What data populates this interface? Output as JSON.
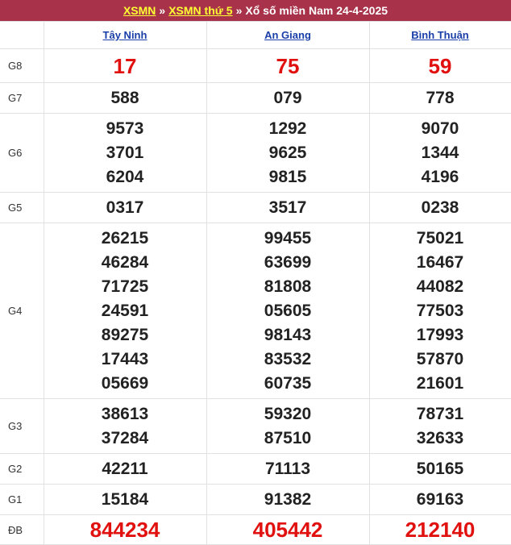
{
  "header": {
    "link1": "XSMN",
    "sep1": "»",
    "link2": "XSMN thứ 5",
    "sep2": "»",
    "title": "Xổ số miền Nam 24-4-2025"
  },
  "provinces": [
    "Tây Ninh",
    "An Giang",
    "Bình Thuận"
  ],
  "prizes": {
    "g8": {
      "label": "G8",
      "values": [
        [
          "17"
        ],
        [
          "75"
        ],
        [
          "59"
        ]
      ]
    },
    "g7": {
      "label": "G7",
      "values": [
        [
          "588"
        ],
        [
          "079"
        ],
        [
          "778"
        ]
      ]
    },
    "g6": {
      "label": "G6",
      "values": [
        [
          "9573",
          "3701",
          "6204"
        ],
        [
          "1292",
          "9625",
          "9815"
        ],
        [
          "9070",
          "1344",
          "4196"
        ]
      ]
    },
    "g5": {
      "label": "G5",
      "values": [
        [
          "0317"
        ],
        [
          "3517"
        ],
        [
          "0238"
        ]
      ]
    },
    "g4": {
      "label": "G4",
      "values": [
        [
          "26215",
          "46284",
          "71725",
          "24591",
          "89275",
          "17443",
          "05669"
        ],
        [
          "99455",
          "63699",
          "81808",
          "05605",
          "98143",
          "83532",
          "60735"
        ],
        [
          "75021",
          "16467",
          "44082",
          "77503",
          "17993",
          "57870",
          "21601"
        ]
      ]
    },
    "g3": {
      "label": "G3",
      "values": [
        [
          "38613",
          "37284"
        ],
        [
          "59320",
          "87510"
        ],
        [
          "78731",
          "32633"
        ]
      ]
    },
    "g2": {
      "label": "G2",
      "values": [
        [
          "42211"
        ],
        [
          "71113"
        ],
        [
          "50165"
        ]
      ]
    },
    "g1": {
      "label": "G1",
      "values": [
        [
          "15184"
        ],
        [
          "91382"
        ],
        [
          "69163"
        ]
      ]
    },
    "db": {
      "label": "ĐB",
      "values": [
        [
          "844234"
        ],
        [
          "405442"
        ],
        [
          "212140"
        ]
      ]
    }
  },
  "colors": {
    "title_bg": "#a7324a",
    "title_link": "#ffff33",
    "province_link": "#1a3ea8",
    "highlight_red": "#e0110f"
  }
}
